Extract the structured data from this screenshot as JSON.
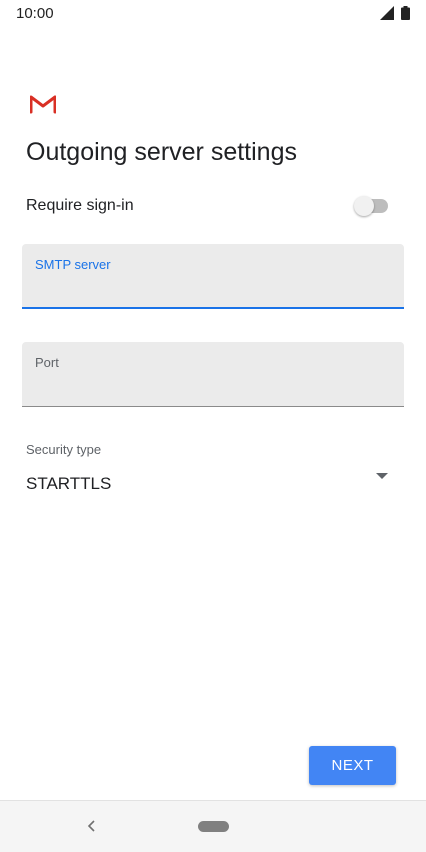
{
  "status_bar": {
    "time": "10:00",
    "icons": [
      "signal-icon",
      "battery-icon"
    ]
  },
  "app": {
    "logo": "gmail-logo-icon",
    "brand_colors": [
      "#d93025",
      "#ea4335"
    ]
  },
  "page": {
    "title": "Outgoing server settings"
  },
  "require_signin": {
    "label": "Require sign-in",
    "enabled": false
  },
  "smtp_server": {
    "label": "SMTP server",
    "value": "",
    "focused": true
  },
  "port": {
    "label": "Port",
    "value": ""
  },
  "security_type": {
    "label": "Security type",
    "selected": "STARTTLS",
    "icon": "dropdown-arrow-icon"
  },
  "actions": {
    "next_label": "NEXT"
  },
  "nav_bar": {
    "icons": [
      "back-icon",
      "home-pill"
    ]
  },
  "colors": {
    "accent": "#1a73e8",
    "button": "#4285f4"
  }
}
